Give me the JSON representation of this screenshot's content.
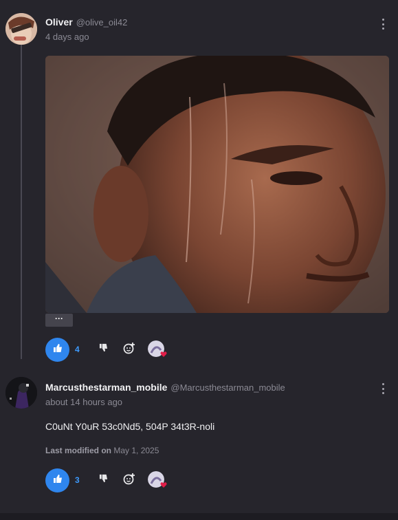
{
  "posts": [
    {
      "author": "Oliver",
      "handle": "@olive_oil42",
      "time": "4 days ago",
      "more_label": "···",
      "likes": "4",
      "icons": [
        "kebab-icon",
        "thumb-up-icon",
        "thumb-down-icon",
        "add-reaction-icon"
      ]
    },
    {
      "author": "Marcusthestarman_mobile",
      "handle": "@Marcusthestarman_mobile",
      "time": "about 14 hours ago",
      "text": "C0uNt Y0uR 53c0Nd5, 504P 34t3R-noli",
      "modified_label": "Last modified on",
      "modified_date": "May 1, 2025",
      "likes": "3"
    }
  ],
  "colors": {
    "background": "#26252c",
    "accent": "#2f86ee",
    "like_count": "#3d9bff",
    "heart": "#e11d48"
  }
}
